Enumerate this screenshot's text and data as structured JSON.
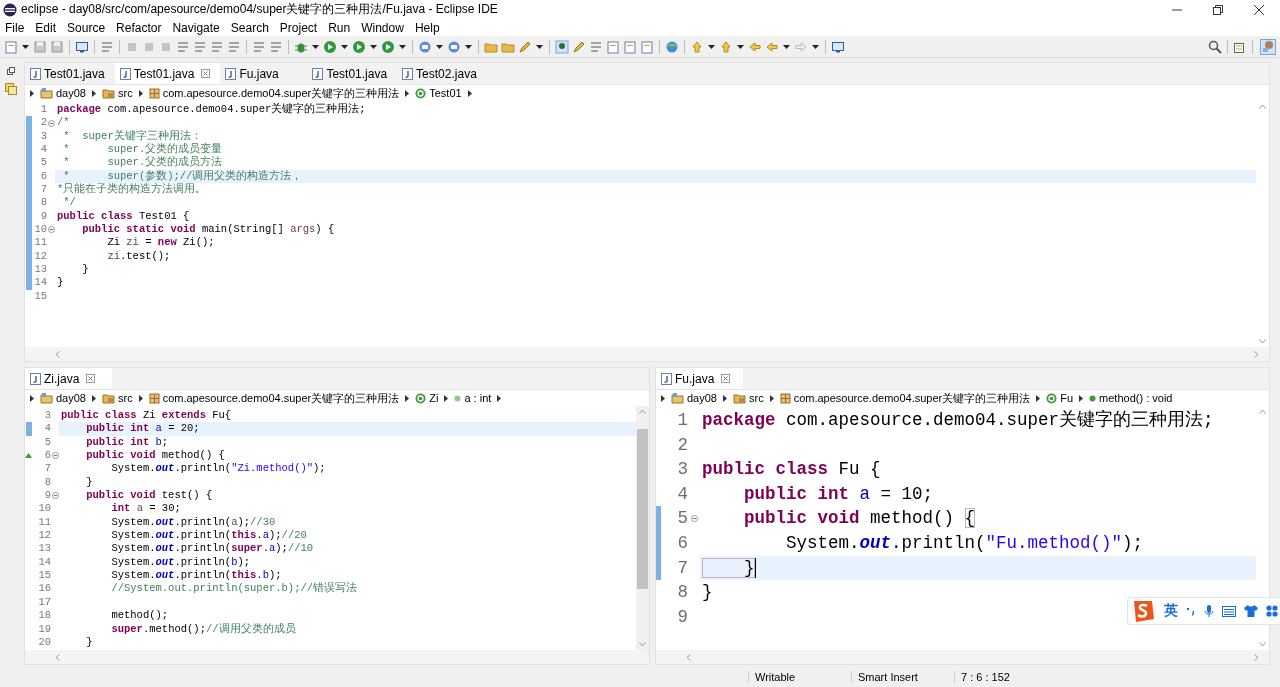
{
  "window": {
    "title": "eclipse - day08/src/com/apesource/demo04/super关键字的三种用法/Fu.java - Eclipse IDE"
  },
  "menu": [
    "File",
    "Edit",
    "Source",
    "Refactor",
    "Navigate",
    "Search",
    "Project",
    "Run",
    "Window",
    "Help"
  ],
  "editor_top": {
    "tabs": [
      {
        "label": "Test01.java",
        "selected": false
      },
      {
        "label": "Test01.java",
        "selected": true
      },
      {
        "label": "Fu.java",
        "selected": false
      },
      {
        "label": "Test01.java",
        "selected": false
      },
      {
        "label": "Test02.java",
        "selected": false
      }
    ],
    "breadcrumb": [
      {
        "kind": "project",
        "text": "day08"
      },
      {
        "kind": "folder",
        "text": "src"
      },
      {
        "kind": "package",
        "text": "com.apesource.demo04.super关键字的三种用法"
      },
      {
        "kind": "class",
        "text": "Test01"
      }
    ],
    "lines": [
      {
        "number": "1",
        "current": false,
        "changed": false,
        "fold": false,
        "tokens": [
          {
            "kind": "kw",
            "text": "package"
          },
          {
            "kind": "plain",
            "text": " com.apesource.demo04.super关键字的三种用法;"
          }
        ]
      },
      {
        "number": "2",
        "current": false,
        "changed": true,
        "fold": true,
        "tokens": [
          {
            "kind": "comment",
            "text": "/*"
          }
        ]
      },
      {
        "number": "3",
        "current": false,
        "changed": true,
        "fold": false,
        "tokens": [
          {
            "kind": "comment",
            "text": " *  super关键字三种用法："
          }
        ]
      },
      {
        "number": "4",
        "current": false,
        "changed": true,
        "fold": false,
        "tokens": [
          {
            "kind": "comment",
            "text": " *      super.父类的成员变量"
          }
        ]
      },
      {
        "number": "5",
        "current": false,
        "changed": true,
        "fold": false,
        "tokens": [
          {
            "kind": "comment",
            "text": " *      super.父类的成员方法"
          }
        ]
      },
      {
        "number": "6",
        "current": true,
        "changed": true,
        "fold": false,
        "tokens": [
          {
            "kind": "comment",
            "text": " *      super(参数);//调用父类的构造方法，"
          }
        ]
      },
      {
        "number": "7",
        "current": false,
        "changed": true,
        "fold": false,
        "tokens": [
          {
            "kind": "comment",
            "text": "*只能在子类的构造方法调用。"
          }
        ]
      },
      {
        "number": "8",
        "current": false,
        "changed": true,
        "fold": false,
        "tokens": [
          {
            "kind": "comment",
            "text": " */"
          }
        ]
      },
      {
        "number": "9",
        "current": false,
        "changed": true,
        "fold": false,
        "tokens": [
          {
            "kind": "kw",
            "text": "public class"
          },
          {
            "kind": "plain",
            "text": " Test01 {"
          }
        ]
      },
      {
        "number": "10",
        "current": false,
        "changed": true,
        "fold": true,
        "tokens": [
          {
            "kind": "kw",
            "text": "    public static void"
          },
          {
            "kind": "plain",
            "text": " main(String[] "
          },
          {
            "kind": "local",
            "text": "args"
          },
          {
            "kind": "plain",
            "text": ") {"
          }
        ]
      },
      {
        "number": "11",
        "current": false,
        "changed": true,
        "fold": false,
        "tokens": [
          {
            "kind": "plain",
            "text": "        Zi "
          },
          {
            "kind": "local",
            "text": "zi"
          },
          {
            "kind": "plain",
            "text": " = "
          },
          {
            "kind": "kw",
            "text": "new"
          },
          {
            "kind": "plain",
            "text": " Zi();"
          }
        ]
      },
      {
        "number": "12",
        "current": false,
        "changed": true,
        "fold": false,
        "tokens": [
          {
            "kind": "local",
            "text": "        zi"
          },
          {
            "kind": "plain",
            "text": ".test();"
          }
        ]
      },
      {
        "number": "13",
        "current": false,
        "changed": true,
        "fold": false,
        "tokens": [
          {
            "kind": "plain",
            "text": "    }"
          }
        ]
      },
      {
        "number": "14",
        "current": false,
        "changed": true,
        "fold": false,
        "tokens": [
          {
            "kind": "plain",
            "text": "}"
          }
        ]
      },
      {
        "number": "15",
        "current": false,
        "changed": false,
        "fold": false
      }
    ]
  },
  "editor_left": {
    "tabs": [
      {
        "label": "Zi.java",
        "selected": true
      }
    ],
    "breadcrumb": [
      {
        "kind": "project",
        "text": "day08"
      },
      {
        "kind": "folder",
        "text": "src"
      },
      {
        "kind": "package",
        "text": "com.apesource.demo04.super关键字的三种用法"
      },
      {
        "kind": "class",
        "text": "Zi"
      },
      {
        "kind": "field",
        "text": "a : int"
      }
    ],
    "lines": [
      {
        "number": "3",
        "current": false,
        "changed": false,
        "fold": false,
        "override": false,
        "tokens": [
          {
            "kind": "kw",
            "text": "public class"
          },
          {
            "kind": "plain",
            "text": " Zi "
          },
          {
            "kind": "kw",
            "text": "extends"
          },
          {
            "kind": "plain",
            "text": " Fu{"
          }
        ]
      },
      {
        "number": "4",
        "current": true,
        "changed": true,
        "fold": false,
        "override": false,
        "tokens": [
          {
            "kind": "kw",
            "text": "    public int "
          },
          {
            "kind": "field",
            "text": "a"
          },
          {
            "kind": "plain",
            "text": " = 20;"
          }
        ]
      },
      {
        "number": "5",
        "current": false,
        "changed": false,
        "fold": false,
        "override": false,
        "tokens": [
          {
            "kind": "kw",
            "text": "    public int "
          },
          {
            "kind": "field",
            "text": "b"
          },
          {
            "kind": "plain",
            "text": ";"
          }
        ]
      },
      {
        "number": "6",
        "current": false,
        "changed": false,
        "fold": true,
        "override": true,
        "tokens": [
          {
            "kind": "kw",
            "text": "    public void"
          },
          {
            "kind": "plain",
            "text": " method() {"
          }
        ]
      },
      {
        "number": "7",
        "current": false,
        "changed": false,
        "fold": false,
        "override": false,
        "tokens": [
          {
            "kind": "plain",
            "text": "        System."
          },
          {
            "kind": "static",
            "text": "out"
          },
          {
            "kind": "plain",
            "text": ".println("
          },
          {
            "kind": "str",
            "text": "\"Zi.method()\""
          },
          {
            "kind": "plain",
            "text": ");"
          }
        ]
      },
      {
        "number": "8",
        "current": false,
        "changed": false,
        "fold": false,
        "override": false,
        "tokens": [
          {
            "kind": "plain",
            "text": "    }"
          }
        ]
      },
      {
        "number": "9",
        "current": false,
        "changed": false,
        "fold": true,
        "override": false,
        "tokens": [
          {
            "kind": "kw",
            "text": "    public void"
          },
          {
            "kind": "plain",
            "text": " test() {"
          }
        ]
      },
      {
        "number": "10",
        "current": false,
        "changed": false,
        "fold": false,
        "override": false,
        "tokens": [
          {
            "kind": "kw",
            "text": "        int "
          },
          {
            "kind": "local",
            "text": "a"
          },
          {
            "kind": "plain",
            "text": " = 30;"
          }
        ]
      },
      {
        "number": "11",
        "current": false,
        "changed": false,
        "fold": false,
        "override": false,
        "tokens": [
          {
            "kind": "plain",
            "text": "        System."
          },
          {
            "kind": "static",
            "text": "out"
          },
          {
            "kind": "plain",
            "text": ".println("
          },
          {
            "kind": "local",
            "text": "a"
          },
          {
            "kind": "plain",
            "text": ");"
          },
          {
            "kind": "comment",
            "text": "//30"
          }
        ]
      },
      {
        "number": "12",
        "current": false,
        "changed": false,
        "fold": false,
        "override": false,
        "tokens": [
          {
            "kind": "plain",
            "text": "        System."
          },
          {
            "kind": "static",
            "text": "out"
          },
          {
            "kind": "plain",
            "text": ".println("
          },
          {
            "kind": "kw",
            "text": "this"
          },
          {
            "kind": "plain",
            "text": "."
          },
          {
            "kind": "field",
            "text": "a"
          },
          {
            "kind": "plain",
            "text": ");"
          },
          {
            "kind": "comment",
            "text": "//20"
          }
        ]
      },
      {
        "number": "13",
        "current": false,
        "changed": false,
        "fold": false,
        "override": false,
        "tokens": [
          {
            "kind": "plain",
            "text": "        System."
          },
          {
            "kind": "static",
            "text": "out"
          },
          {
            "kind": "plain",
            "text": ".println("
          },
          {
            "kind": "kw",
            "text": "super"
          },
          {
            "kind": "plain",
            "text": "."
          },
          {
            "kind": "field",
            "text": "a"
          },
          {
            "kind": "plain",
            "text": ");"
          },
          {
            "kind": "comment",
            "text": "//10"
          }
        ]
      },
      {
        "number": "14",
        "current": false,
        "changed": false,
        "fold": false,
        "override": false,
        "tokens": [
          {
            "kind": "plain",
            "text": "        System."
          },
          {
            "kind": "static",
            "text": "out"
          },
          {
            "kind": "plain",
            "text": ".println("
          },
          {
            "kind": "field",
            "text": "b"
          },
          {
            "kind": "plain",
            "text": ");"
          }
        ]
      },
      {
        "number": "15",
        "current": false,
        "changed": false,
        "fold": false,
        "override": false,
        "tokens": [
          {
            "kind": "plain",
            "text": "        System."
          },
          {
            "kind": "static",
            "text": "out"
          },
          {
            "kind": "plain",
            "text": ".println("
          },
          {
            "kind": "kw",
            "text": "this"
          },
          {
            "kind": "plain",
            "text": "."
          },
          {
            "kind": "field",
            "text": "b"
          },
          {
            "kind": "plain",
            "text": ");"
          }
        ]
      },
      {
        "number": "16",
        "current": false,
        "changed": false,
        "fold": false,
        "override": false,
        "tokens": [
          {
            "kind": "comment",
            "text": "        //System.out.println(super.b);//错误写法"
          }
        ]
      },
      {
        "number": "17",
        "current": false,
        "changed": false,
        "fold": false,
        "override": false
      },
      {
        "number": "18",
        "current": false,
        "changed": false,
        "fold": false,
        "override": false,
        "tokens": [
          {
            "kind": "plain",
            "text": "        method();"
          }
        ]
      },
      {
        "number": "19",
        "current": false,
        "changed": false,
        "fold": false,
        "override": false,
        "tokens": [
          {
            "kind": "kw",
            "text": "        super"
          },
          {
            "kind": "plain",
            "text": ".method();"
          },
          {
            "kind": "comment",
            "text": "//调用父类的成员"
          }
        ]
      },
      {
        "number": "20",
        "current": false,
        "changed": false,
        "fold": false,
        "override": false,
        "tokens": [
          {
            "kind": "plain",
            "text": "    }"
          }
        ]
      }
    ]
  },
  "editor_right": {
    "tabs": [
      {
        "label": "Fu.java",
        "selected": true
      }
    ],
    "breadcrumb": [
      {
        "kind": "project",
        "text": "day08"
      },
      {
        "kind": "folder",
        "text": "src"
      },
      {
        "kind": "package",
        "text": "com.apesource.demo04.super关键字的三种用法"
      },
      {
        "kind": "class",
        "text": "Fu"
      },
      {
        "kind": "method",
        "text": "method() : void"
      }
    ],
    "lines": [
      {
        "number": "1",
        "current": false,
        "changed": false,
        "fold": false,
        "cursor": false,
        "tokens": [
          {
            "kind": "kw",
            "text": "package"
          },
          {
            "kind": "plain",
            "text": " com.apesource.demo04.super关键字的三种用法;"
          }
        ]
      },
      {
        "number": "2",
        "current": false,
        "changed": false,
        "fold": false,
        "cursor": false
      },
      {
        "number": "3",
        "current": false,
        "changed": false,
        "fold": false,
        "cursor": false,
        "tokens": [
          {
            "kind": "kw",
            "text": "public class"
          },
          {
            "kind": "plain",
            "text": " Fu {"
          }
        ]
      },
      {
        "number": "4",
        "current": false,
        "changed": false,
        "fold": false,
        "cursor": false,
        "tokens": [
          {
            "kind": "kw",
            "text": "    public int "
          },
          {
            "kind": "field",
            "text": "a"
          },
          {
            "kind": "plain",
            "text": " = 10;"
          }
        ]
      },
      {
        "number": "5",
        "current": false,
        "changed": true,
        "fold": true,
        "cursor": false,
        "tokens": [
          {
            "kind": "kw",
            "text": "    public void"
          },
          {
            "kind": "plain",
            "text": " method() "
          },
          {
            "kind": "bracket",
            "text": "{"
          }
        ]
      },
      {
        "number": "6",
        "current": false,
        "changed": true,
        "fold": false,
        "cursor": false,
        "tokens": [
          {
            "kind": "plain",
            "text": "        System."
          },
          {
            "kind": "static",
            "text": "out"
          },
          {
            "kind": "plain",
            "text": ".println("
          },
          {
            "kind": "str",
            "text": "\"Fu.method()\""
          },
          {
            "kind": "plain",
            "text": ");"
          }
        ]
      },
      {
        "number": "7",
        "current": true,
        "changed": true,
        "fold": false,
        "cursor": true,
        "tokens": [
          {
            "kind": "bracket",
            "text": "    }"
          }
        ]
      },
      {
        "number": "8",
        "current": false,
        "changed": false,
        "fold": false,
        "cursor": false,
        "tokens": [
          {
            "kind": "plain",
            "text": "}"
          }
        ]
      },
      {
        "number": "9",
        "current": false,
        "changed": false,
        "fold": false,
        "cursor": false
      }
    ]
  },
  "ime_toolbar": {
    "label": "英"
  },
  "status_bar": [
    "Writable",
    "Smart Insert",
    "7 : 6 : 152"
  ]
}
